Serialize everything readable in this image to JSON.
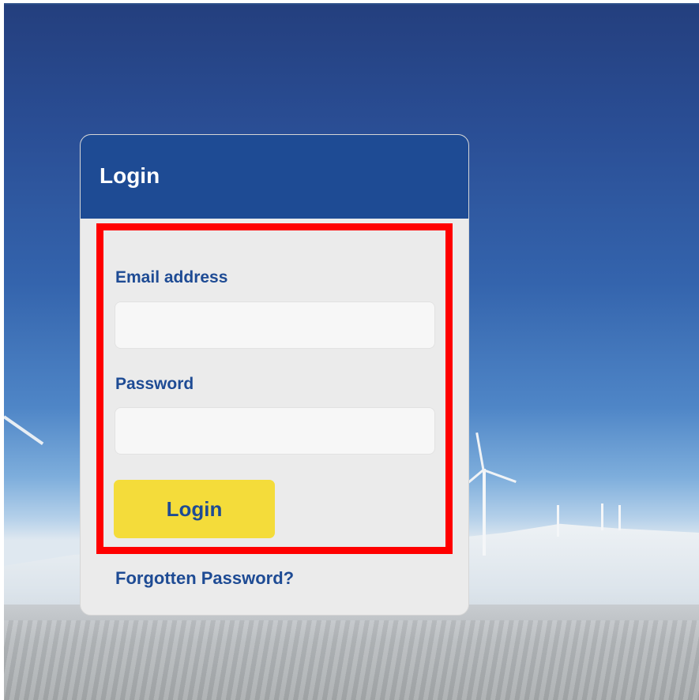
{
  "login": {
    "title": "Login",
    "email_label": "Email address",
    "email_value": "",
    "password_label": "Password",
    "password_value": "",
    "submit_label": "Login",
    "forgot_link": "Forgotten Password?"
  },
  "colors": {
    "brand_blue": "#1e4b94",
    "button_yellow": "#f4dc3a",
    "highlight_red": "#ff0000"
  }
}
